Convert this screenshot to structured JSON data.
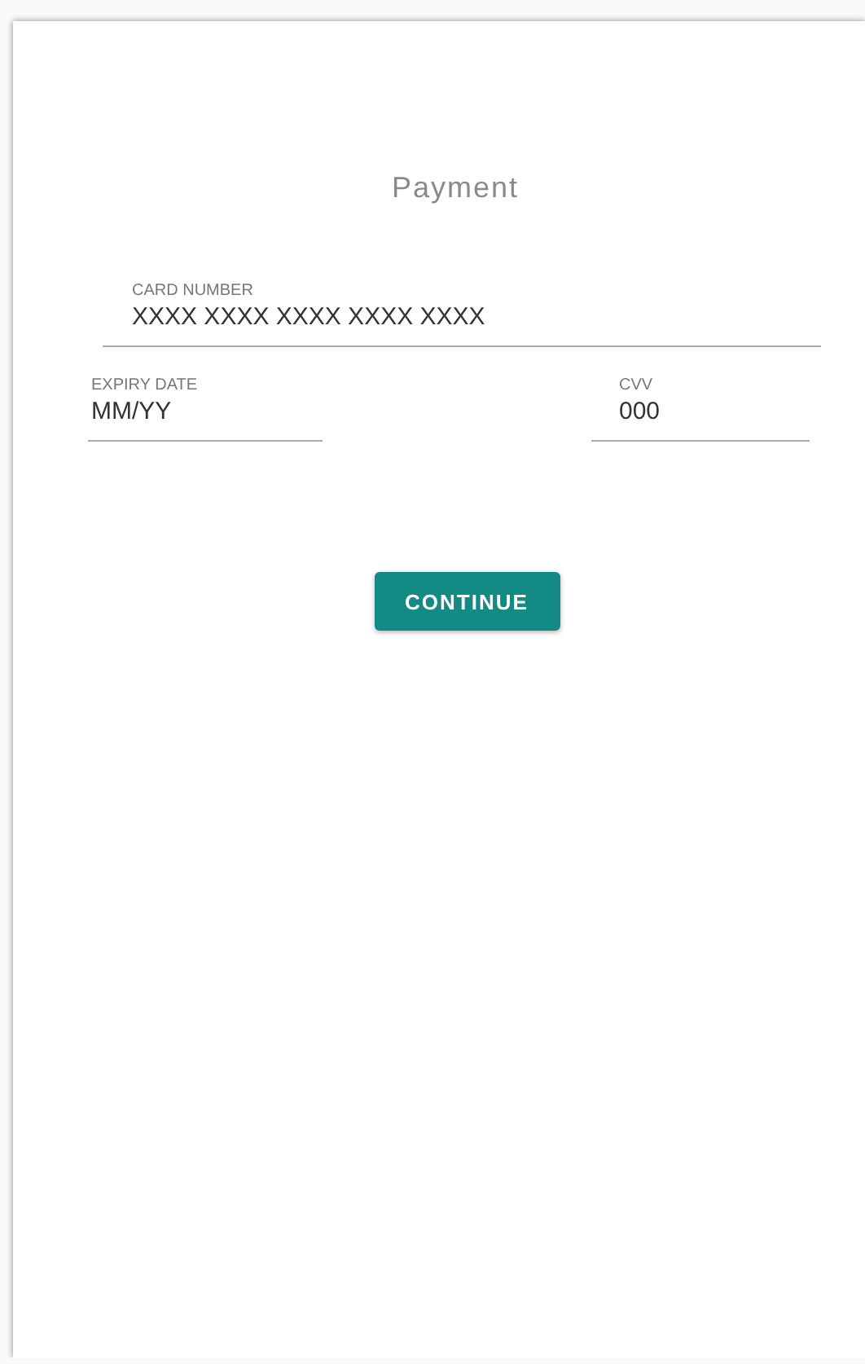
{
  "title": "Payment",
  "fields": [
    {
      "label": "CARD NUMBER",
      "placeholder": "XXXX XXXX XXXX XXXX XXXX",
      "kind": "wide"
    },
    {
      "label": "EXPIRY DATE",
      "placeholder": "MM/YY",
      "kind": "left"
    },
    {
      "label": "CVV",
      "placeholder": "000",
      "kind": "right"
    }
  ],
  "button": "CONTINUE"
}
